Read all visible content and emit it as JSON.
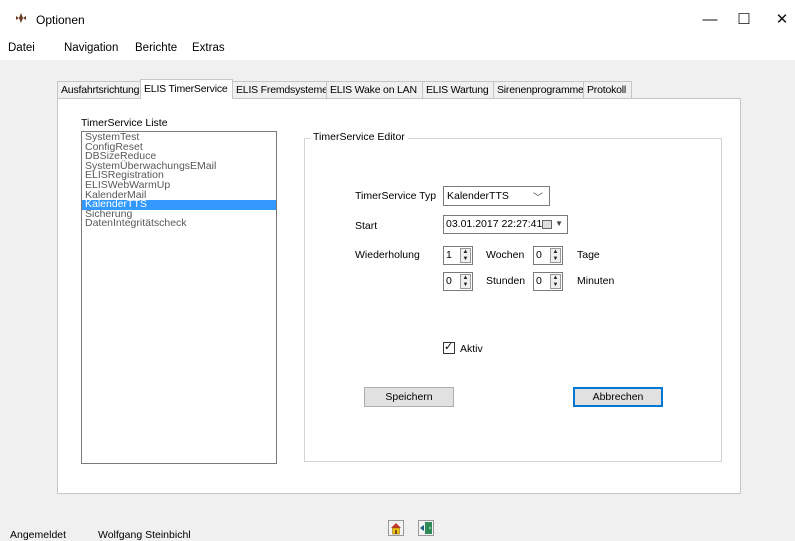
{
  "window": {
    "title": "Optionen",
    "minimize_glyph": "—",
    "maximize_glyph": "☐",
    "close_glyph": "✕"
  },
  "menu": [
    "Datei",
    "Navigation",
    "Berichte",
    "Extras"
  ],
  "tabs": [
    {
      "label": "Ausfahrtsrichtung",
      "active": false
    },
    {
      "label": "ELIS TimerService",
      "active": true
    },
    {
      "label": "ELIS Fremdsysteme",
      "active": false
    },
    {
      "label": "ELIS Wake on LAN",
      "active": false
    },
    {
      "label": "ELIS Wartung",
      "active": false
    },
    {
      "label": "Sirenenprogramme",
      "active": false
    },
    {
      "label": "Protokoll",
      "active": false
    }
  ],
  "list": {
    "label": "TimerService Liste",
    "items": [
      "SystemTest",
      "ConfigReset",
      "DBSizeReduce",
      "SystemÜberwachungsEMail",
      "ELISRegistration",
      "ELISWebWarmUp",
      "KalenderMail",
      "KalenderTTS",
      "Sicherung",
      "DatenIntegritätscheck"
    ],
    "selected": "KalenderTTS"
  },
  "editor": {
    "title": "TimerService Editor",
    "typ_label": "TimerService Typ",
    "typ_value": "KalenderTTS",
    "start_label": "Start",
    "start_value": "03.01.2017 22:27:41",
    "wiederholung_label": "Wiederholung",
    "wochen_value": "1",
    "wochen_label": "Wochen",
    "tage_value": "0",
    "tage_label": "Tage",
    "stunden_value": "0",
    "stunden_label": "Stunden",
    "minuten_value": "0",
    "minuten_label": "Minuten",
    "aktiv_label": "Aktiv",
    "aktiv_checked": true,
    "save_label": "Speichern",
    "cancel_label": "Abbrechen"
  },
  "status": {
    "label": "Angemeldet",
    "user": "Wolfgang Steinbichl"
  },
  "icons": {
    "app": "app-icon",
    "home": "home-icon",
    "exit": "exit-door-icon"
  },
  "colors": {
    "selection": "#3399ff",
    "default_button_border": "#0078d7"
  }
}
